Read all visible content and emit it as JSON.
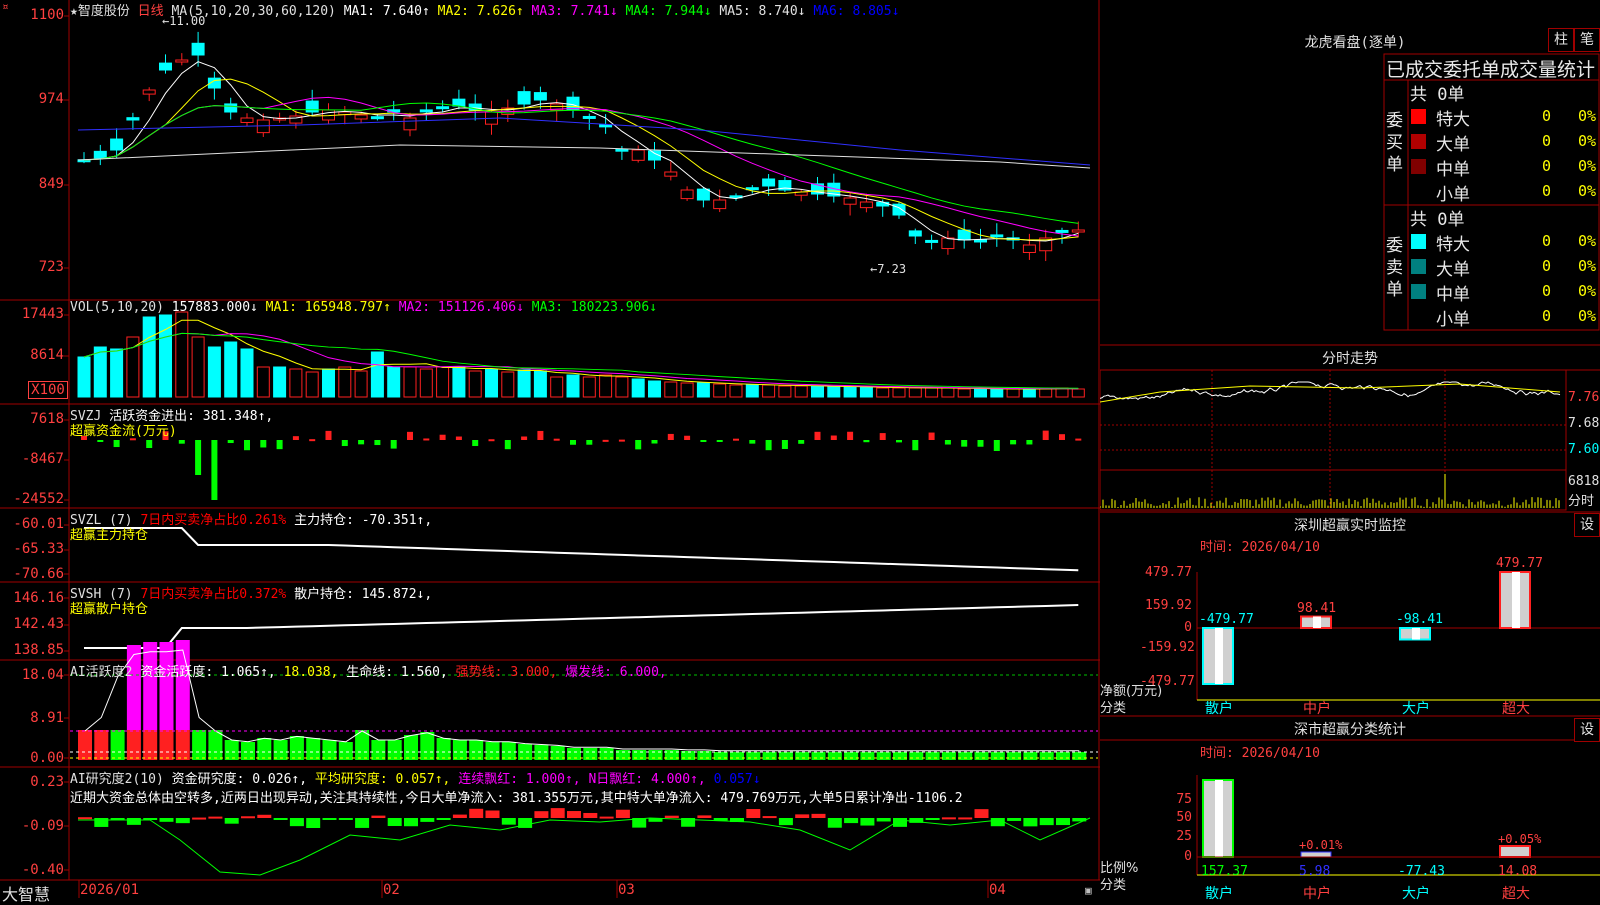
{
  "stock": {
    "name": "★智度股份",
    "period": "日线"
  },
  "main_header": {
    "ma_label": "MA(5,10,20,30,60,120)",
    "ma1": "MA1: 7.640↑",
    "ma2": "MA2: 7.626↑",
    "ma3": "MA3: 7.741↓",
    "ma4": "MA4: 7.944↓",
    "ma5": "MA5: 8.740↓",
    "ma6": "MA6: 8.805↓",
    "high_mark": "11.00",
    "low_mark": "7.23",
    "yticks": [
      "1100",
      "974",
      "849",
      "723"
    ]
  },
  "vol": {
    "label": "VOL(5,10,20)",
    "value": "157883.000↓",
    "ma1": "MA1: 165948.797↑",
    "ma2": "MA2: 151126.406↓",
    "ma3": "MA3: 180223.906↓",
    "yticks": [
      "17443",
      "8614",
      "X100"
    ]
  },
  "svzj": {
    "label": "SVZJ",
    "title": "活跃资金进出: 381.348↑,",
    "sub": "超赢资金流(万元)",
    "yticks": [
      "7618",
      "-8467",
      "-24552"
    ]
  },
  "svzl": {
    "label": "SVZL (7)",
    "ratio": "7日内买卖净占比0.261%",
    "title": "主力持仓: -70.351↑,",
    "sub": "超赢主力持仓",
    "yticks": [
      "-60.01",
      "-65.33",
      "-70.66"
    ]
  },
  "svsh": {
    "label": "SVSH (7)",
    "ratio": "7日内买卖净占比0.372%",
    "title": "散户持仓: 145.872↓,",
    "sub": "超赢散户持仓",
    "yticks": [
      "146.16",
      "142.43",
      "138.85"
    ]
  },
  "ai_active": {
    "label": "AI活跃度2",
    "v1": "资金活跃度: 1.065↑,",
    "v2": "18.038,",
    "v3": "生命线: 1.560,",
    "v4": "强势线: 3.000,",
    "v5": "爆发线: 6.000,",
    "yticks": [
      "18.04",
      "8.91",
      "0.00"
    ]
  },
  "ai_research": {
    "label": "AI研究度2(10)",
    "v1": "资金研究度: 0.026↑,",
    "v2": "平均研究度: 0.057↑,",
    "v3": "连续飘红: 1.000↑,",
    "v4": "N日飘红: 4.000↑,",
    "v5": "0.057↓",
    "note": "近期大资金总体由空转多,近两日出现异动,关注其持续性,今日大单净流入: 381.355万元,其中特大单净流入: 479.769万元,大单5日累计净出-1106.2",
    "yticks": [
      "0.23",
      "-0.09",
      "-0.40"
    ]
  },
  "xaxis": {
    "labels": [
      "2026/01",
      "02",
      "03",
      "04"
    ]
  },
  "brand": "大智慧",
  "longhu": {
    "title": "龙虎看盘(逐单)",
    "tab_zhu": "柱",
    "tab_bi": "笔",
    "subtitle": "已成交委托单成交量统计",
    "buy_label": "委买单",
    "sell_label": "委卖单",
    "buy_total": "共 0单",
    "sell_total": "共 0单",
    "rows": [
      {
        "name": "特大",
        "val": "0",
        "pct": "0%"
      },
      {
        "name": "大单",
        "val": "0",
        "pct": "0%"
      },
      {
        "name": "中单",
        "val": "0",
        "pct": "0%"
      },
      {
        "name": "小单",
        "val": "0",
        "pct": "0%"
      }
    ],
    "colors": {
      "buy": [
        "#ff0000",
        "#b00000",
        "#800000",
        "#000000"
      ],
      "sell": [
        "#00ffff",
        "#008080",
        "#008080",
        "#000000"
      ]
    }
  },
  "fenshi": {
    "title": "分时走势",
    "yticks": [
      "7.76",
      "7.68",
      "7.60"
    ],
    "vol_top": "6818",
    "vol_label": "分时"
  },
  "sz_monitor": {
    "title": "深圳超赢实时监控",
    "time": "时间: 2026/04/10",
    "btn": "设",
    "yticks": [
      "479.77",
      "159.92",
      "0",
      "-159.92",
      "-479.77"
    ],
    "ylabel": "净额(万元)",
    "xlabel": "分类",
    "categories": [
      "散户",
      "中户",
      "大户",
      "超大"
    ],
    "values": [
      "-479.77",
      "98.41",
      "-98.41",
      "479.77"
    ]
  },
  "sz_stats": {
    "title": "深市超赢分类统计",
    "time": "时间: 2026/04/10",
    "btn": "设",
    "yticks": [
      "75",
      "50",
      "25",
      "0"
    ],
    "ylabel": "比例%",
    "xlabel": "分类",
    "categories": [
      "散户",
      "中户",
      "大户",
      "超大"
    ],
    "values": [
      "157.37",
      "5.98",
      "-77.43",
      "14.08"
    ],
    "labels": [
      "+0.01%",
      "+0.05%"
    ]
  }
}
